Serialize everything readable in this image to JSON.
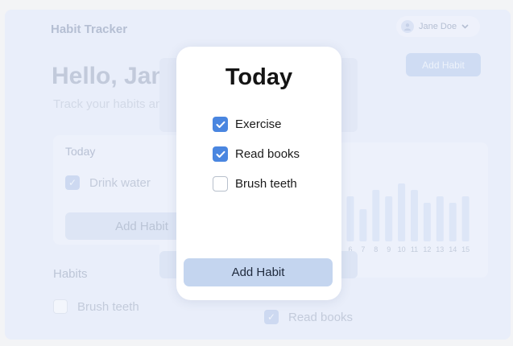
{
  "app": {
    "title": "Habit Tracker"
  },
  "user": {
    "name": "Jane Doe"
  },
  "header": {
    "add_habit_label": "Add Habit"
  },
  "greeting": {
    "title": "Hello, Jane!",
    "subtitle": "Track your habits and build a better you"
  },
  "today_card": {
    "title": "Today",
    "items": [
      {
        "label": "Drink water",
        "checked": true
      }
    ],
    "add_label": "Add Habit"
  },
  "habits_section": {
    "title": "Habits",
    "items": [
      {
        "label": "Brush teeth",
        "checked": false
      },
      {
        "label": "Read books",
        "checked": true
      }
    ]
  },
  "chart_data": {
    "type": "bar",
    "categories": [
      "6",
      "7",
      "8",
      "9",
      "10",
      "11",
      "12",
      "13",
      "14",
      "15"
    ],
    "values": [
      7,
      5,
      8,
      7,
      9,
      8,
      6,
      7,
      6,
      7
    ],
    "ylim": [
      0,
      10
    ],
    "colors": {
      "bar": "#dde6f7",
      "tick": "#c3ccdc"
    }
  },
  "modal": {
    "title": "Today",
    "items": [
      {
        "label": "Exercise",
        "checked": true
      },
      {
        "label": "Read books",
        "checked": true
      },
      {
        "label": "Brush teeth",
        "checked": false
      }
    ],
    "add_label": "Add Habit"
  },
  "colors": {
    "accent": "#4a86e0",
    "modal_button": "#c4d5ef",
    "background": "#e9eefa"
  }
}
